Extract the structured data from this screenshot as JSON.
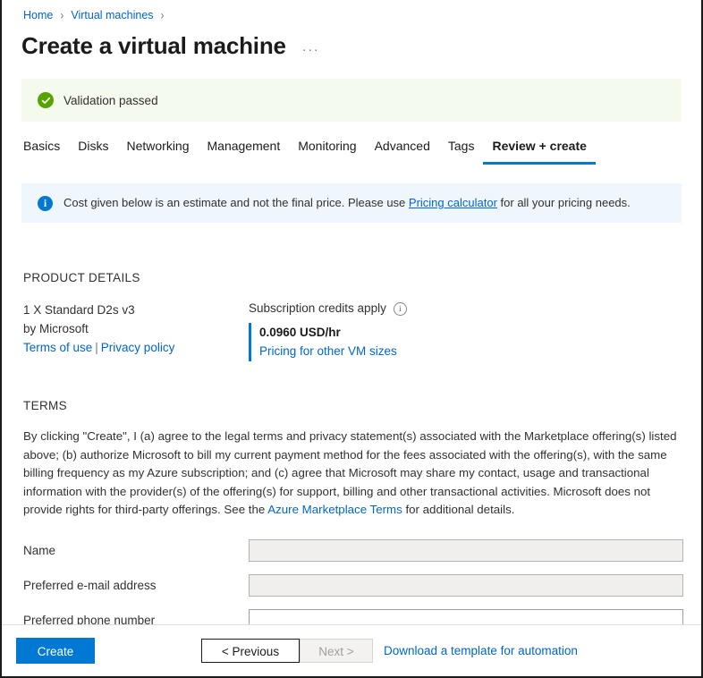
{
  "breadcrumb": {
    "items": [
      {
        "label": "Home"
      },
      {
        "label": "Virtual machines"
      }
    ],
    "separator": "›"
  },
  "header": {
    "title": "Create a virtual machine",
    "more_menu": "···"
  },
  "validation": {
    "text": "Validation passed",
    "icon": "check-circle-icon",
    "background": "#f4faed",
    "accent": "#57a300"
  },
  "tabs": [
    {
      "label": "Basics",
      "active": false
    },
    {
      "label": "Disks",
      "active": false
    },
    {
      "label": "Networking",
      "active": false
    },
    {
      "label": "Management",
      "active": false
    },
    {
      "label": "Monitoring",
      "active": false
    },
    {
      "label": "Advanced",
      "active": false
    },
    {
      "label": "Tags",
      "active": false
    },
    {
      "label": "Review + create",
      "active": true
    }
  ],
  "info_banner": {
    "icon": "info-circle-icon",
    "text_before": "Cost given below is an estimate and not the final price. Please use",
    "link": "Pricing calculator",
    "text_after": "for all your pricing needs.",
    "background": "#eff6fc",
    "accent": "#0078d4"
  },
  "product_details": {
    "heading": "PRODUCT DETAILS",
    "sku": "1 X Standard D2s v3",
    "publisher": "by Microsoft",
    "terms_of_use_link": "Terms of use",
    "link_separator": "|",
    "privacy_policy_link": "Privacy policy",
    "credits_label": "Subscription credits apply",
    "credits_info_icon": "info-outline-icon",
    "price": "0.0960 USD/hr",
    "other_sizes_link": "Pricing for other VM sizes",
    "accent": "#0078d4"
  },
  "terms": {
    "heading": "TERMS",
    "body_before": "By clicking \"Create\", I (a) agree to the legal terms and privacy statement(s) associated with the Marketplace offering(s) listed above; (b) authorize Microsoft to bill my current payment method for the fees associated with the offering(s), with the same billing frequency as my Azure subscription; and (c) agree that Microsoft may share my contact, usage and transactional information with the provider(s) of the offering(s) for support, billing and other transactional activities. Microsoft does not provide rights for third-party offerings. See the",
    "link": "Azure Marketplace Terms",
    "body_after": "for additional details."
  },
  "form": {
    "fields": [
      {
        "label": "Name",
        "value": "",
        "placeholder": "",
        "disabled": true
      },
      {
        "label": "Preferred e-mail address",
        "value": "",
        "placeholder": "",
        "disabled": true
      },
      {
        "label": "Preferred phone number",
        "value": "",
        "placeholder": "",
        "disabled": false
      }
    ]
  },
  "footer": {
    "create_label": "Create",
    "previous_label": "< Previous",
    "next_label": "Next >",
    "download_template_link": "Download a template for automation",
    "primary_color": "#0078d4"
  }
}
